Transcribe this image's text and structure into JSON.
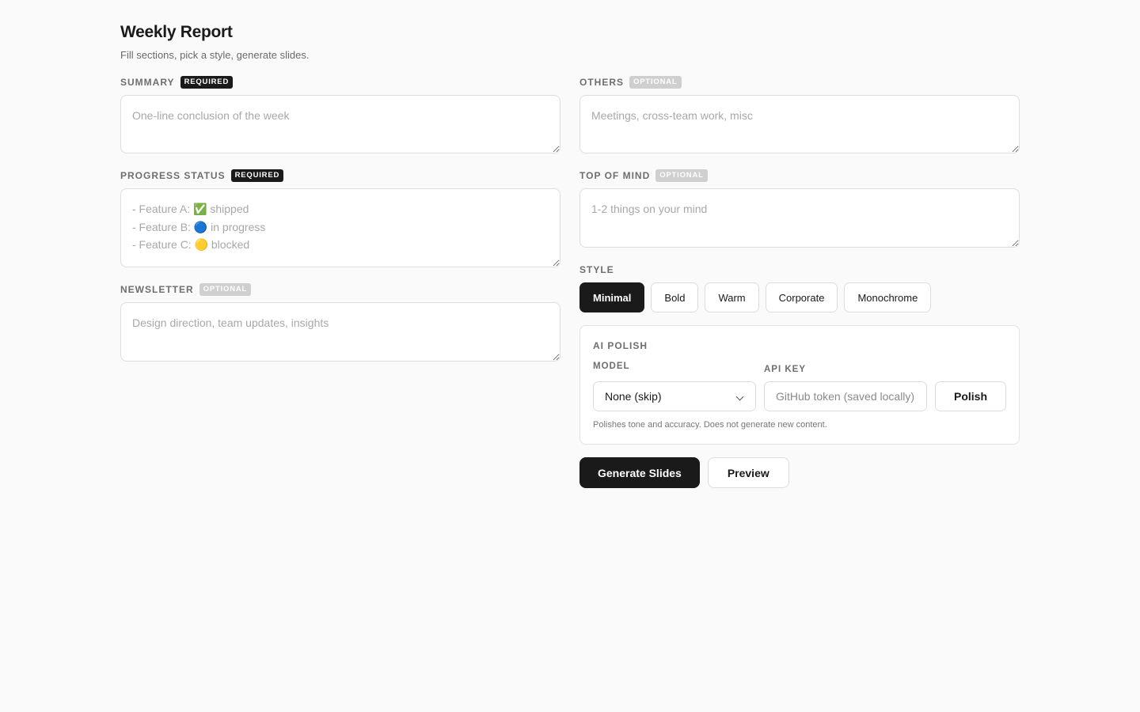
{
  "header": {
    "title": "Weekly Report",
    "subtitle": "Fill sections, pick a style, generate slides."
  },
  "badges": {
    "required": "REQUIRED",
    "optional": "OPTIONAL"
  },
  "fields": {
    "summary": {
      "label": "SUMMARY",
      "placeholder": "One-line conclusion of the week",
      "value": ""
    },
    "progress": {
      "label": "PROGRESS STATUS",
      "placeholder": "- Feature A: ✅ shipped\n- Feature B: 🔵 in progress\n- Feature C: 🟡 blocked",
      "value": ""
    },
    "newsletter": {
      "label": "NEWSLETTER",
      "placeholder": "Design direction, team updates, insights",
      "value": ""
    },
    "others": {
      "label": "OTHERS",
      "placeholder": "Meetings, cross-team work, misc",
      "value": ""
    },
    "top_of_mind": {
      "label": "TOP OF MIND",
      "placeholder": "1-2 things on your mind",
      "value": ""
    }
  },
  "style": {
    "label": "STYLE",
    "options": [
      "Minimal",
      "Bold",
      "Warm",
      "Corporate",
      "Monochrome"
    ],
    "selected": "Minimal"
  },
  "ai_polish": {
    "title": "AI POLISH",
    "model_label": "MODEL",
    "model_value": "None (skip)",
    "api_key_label": "API KEY",
    "api_key_placeholder": "GitHub token (saved locally)",
    "api_key_value": "",
    "polish_button": "Polish",
    "note": "Polishes tone and accuracy. Does not generate new content."
  },
  "actions": {
    "generate": "Generate Slides",
    "preview": "Preview"
  },
  "colors": {
    "primary": "#1a1a1a",
    "background": "#fafafa",
    "optional_badge": "#cfcfcf"
  }
}
